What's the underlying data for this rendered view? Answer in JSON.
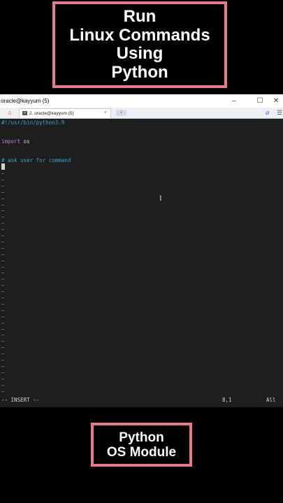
{
  "title": {
    "lines": [
      "Run",
      "Linux Commands",
      "Using",
      "Python"
    ]
  },
  "window": {
    "title": "oracle@kayyum (5)",
    "buttons": [
      "–",
      "☐",
      "✕"
    ],
    "tab_label": "2. oracle@kayyum (5)",
    "tab_close": "×",
    "newtab": "+"
  },
  "editor": {
    "shebang": "#!/usr/bin/python3.9",
    "import_kw": "import",
    "import_rest": " os",
    "comment": "# ask user for command",
    "tilde": "~",
    "status_mode": "-- INSERT --",
    "cursor_pos": "8,1",
    "scroll_pos": "All"
  },
  "subtitle": {
    "lines": [
      "Python",
      "OS Module"
    ]
  },
  "colors": {
    "frame": "#e8788c",
    "terminal_bg": "#1e1e1e",
    "comment": "#3fa3c9",
    "keyword": "#c678dd"
  },
  "icons": {
    "home": "home-icon",
    "terminal": "terminal-icon",
    "attach": "paperclip-icon",
    "menu": "menu-icon"
  }
}
